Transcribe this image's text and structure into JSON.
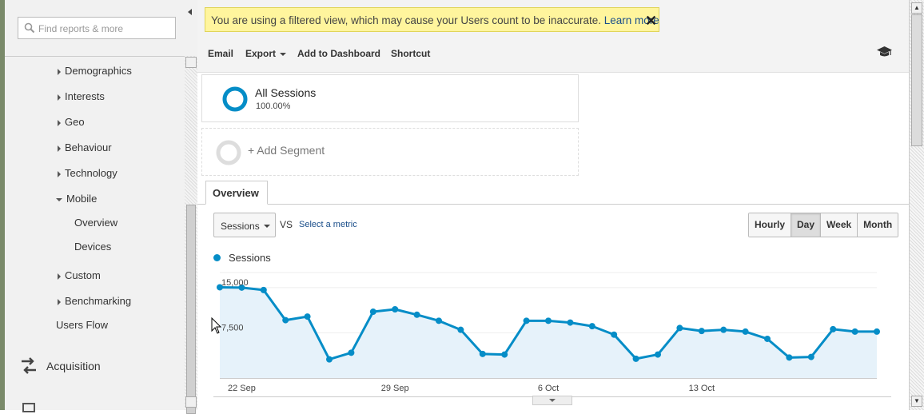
{
  "search": {
    "placeholder": "Find reports & more"
  },
  "sidebar": {
    "items": [
      {
        "label": "Demographics",
        "expander": "collapsed"
      },
      {
        "label": "Interests",
        "expander": "collapsed"
      },
      {
        "label": "Geo",
        "expander": "collapsed"
      },
      {
        "label": "Behaviour",
        "expander": "collapsed"
      },
      {
        "label": "Technology",
        "expander": "collapsed"
      },
      {
        "label": "Mobile",
        "expander": "expanded"
      },
      {
        "label": "Overview",
        "expander": "none"
      },
      {
        "label": "Devices",
        "expander": "none"
      },
      {
        "label": "Custom",
        "expander": "collapsed"
      },
      {
        "label": "Benchmarking",
        "expander": "collapsed"
      },
      {
        "label": "Users Flow",
        "expander": "none"
      }
    ],
    "sections": [
      {
        "label": "Acquisition",
        "icon": "acquisition-arrows-icon"
      }
    ]
  },
  "banner": {
    "text": "You are using a filtered view, which may cause your Users count to be inaccurate.",
    "link": "Learn more",
    "close": "✕",
    "color": "#fff59d"
  },
  "toolbar": {
    "email": "Email",
    "export": "Export",
    "add_dashboard": "Add to Dashboard",
    "shortcut": "Shortcut",
    "help_icon": "graduation-cap-icon"
  },
  "segments": [
    {
      "name": "All Sessions",
      "percent": "100.00%"
    },
    {
      "name": "+ Add Segment"
    }
  ],
  "tabs": [
    {
      "label": "Overview"
    }
  ],
  "chart_controls": {
    "metric": "Sessions",
    "vs": "VS",
    "select_metric": "Select a metric",
    "periods": [
      "Hourly",
      "Day",
      "Week",
      "Month"
    ],
    "active_period": "Day"
  },
  "chart_data": {
    "type": "area",
    "series": [
      {
        "name": "Sessions",
        "color": "#058dc7",
        "values": [
          15050,
          15000,
          14600,
          9600,
          10200,
          3100,
          4200,
          11000,
          11400,
          10500,
          9500,
          8000,
          4000,
          3900,
          9500,
          9500,
          9200,
          8600,
          7200,
          3200,
          3900,
          8300,
          7800,
          8000,
          7700,
          6500,
          3400,
          3500,
          8100,
          7700,
          7700
        ]
      }
    ],
    "x_tick_labels": [
      "22 Sep",
      "29 Sep",
      "6 Oct",
      "13 Oct"
    ],
    "x_tick_index": [
      1,
      8,
      15,
      22
    ],
    "y_tick_labels": [
      "15,000",
      "7,500"
    ],
    "y_ticks": [
      15000,
      7500
    ],
    "ylim": [
      0,
      17500
    ]
  }
}
